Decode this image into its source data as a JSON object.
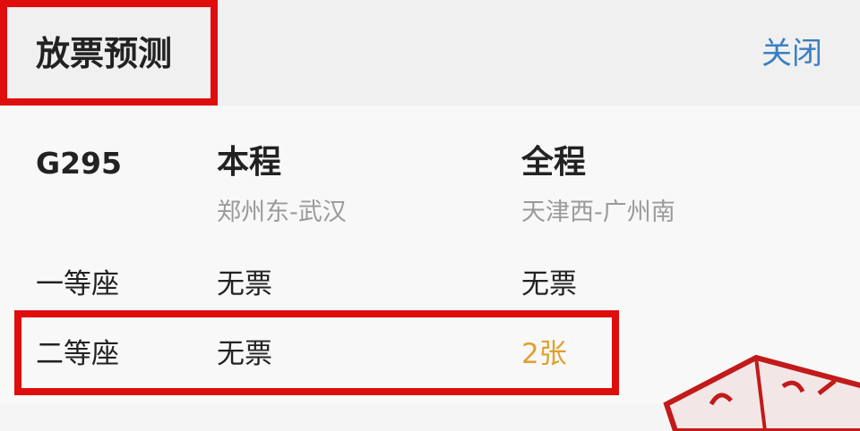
{
  "header": {
    "title": "放票预测",
    "close_label": "关闭"
  },
  "train": {
    "number": "G295"
  },
  "columns": [
    {
      "heading": "本程",
      "route": "郑州东-武汉"
    },
    {
      "heading": "全程",
      "route": "天津西-广州南"
    }
  ],
  "seats": [
    {
      "label": "一等座",
      "segment": "无票",
      "full": "无票"
    },
    {
      "label": "二等座",
      "segment": "无票",
      "full": "2张"
    }
  ],
  "colors": {
    "highlight_box": "#e00d0d",
    "close_link": "#3a7fc4",
    "available_tickets": "#e0a030",
    "stamp": "#c21a1a"
  }
}
